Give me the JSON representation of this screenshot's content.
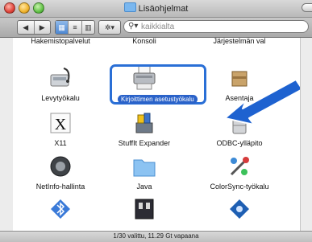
{
  "window": {
    "title": "Lisäohjelmat"
  },
  "toolbar": {
    "back_label": "◀",
    "forward_label": "▶",
    "view_icon_label": "▦",
    "view_list_label": "≡",
    "view_column_label": "▥",
    "action_label": "✲▾",
    "search_placeholder": "kaikkialta"
  },
  "items": [
    {
      "label": "Hakemistopalvelut",
      "icon": "directory-utility-icon"
    },
    {
      "label": "Konsoli",
      "icon": "console-icon"
    },
    {
      "label": "Järjestelmän val",
      "icon": "system-profiler-icon"
    },
    {
      "label": "Levytyökalu",
      "icon": "disk-utility-icon"
    },
    {
      "label": "Kirjoittimen asetustyökalu",
      "icon": "printer-setup-icon",
      "selected": true
    },
    {
      "label": "Asentaja",
      "icon": "installer-icon"
    },
    {
      "label": "X11",
      "icon": "x11-icon"
    },
    {
      "label": "StuffIt Expander",
      "icon": "stuffit-icon"
    },
    {
      "label": "ODBC-ylläpito",
      "icon": "odbc-icon"
    },
    {
      "label": "NetInfo-hallinta",
      "icon": "netinfo-icon"
    },
    {
      "label": "Java",
      "icon": "java-folder-icon"
    },
    {
      "label": "ColorSync-työkalu",
      "icon": "colorsync-icon"
    },
    {
      "label": "",
      "icon": "bluetooth-icon"
    },
    {
      "label": "",
      "icon": "audio-midi-icon"
    },
    {
      "label": "",
      "icon": "directory-access-icon"
    }
  ],
  "status": {
    "text": "1/30 valittu, 11.29 Gt vapaana"
  },
  "colors": {
    "selection": "#2a6fd6",
    "arrow": "#1e62d0"
  }
}
